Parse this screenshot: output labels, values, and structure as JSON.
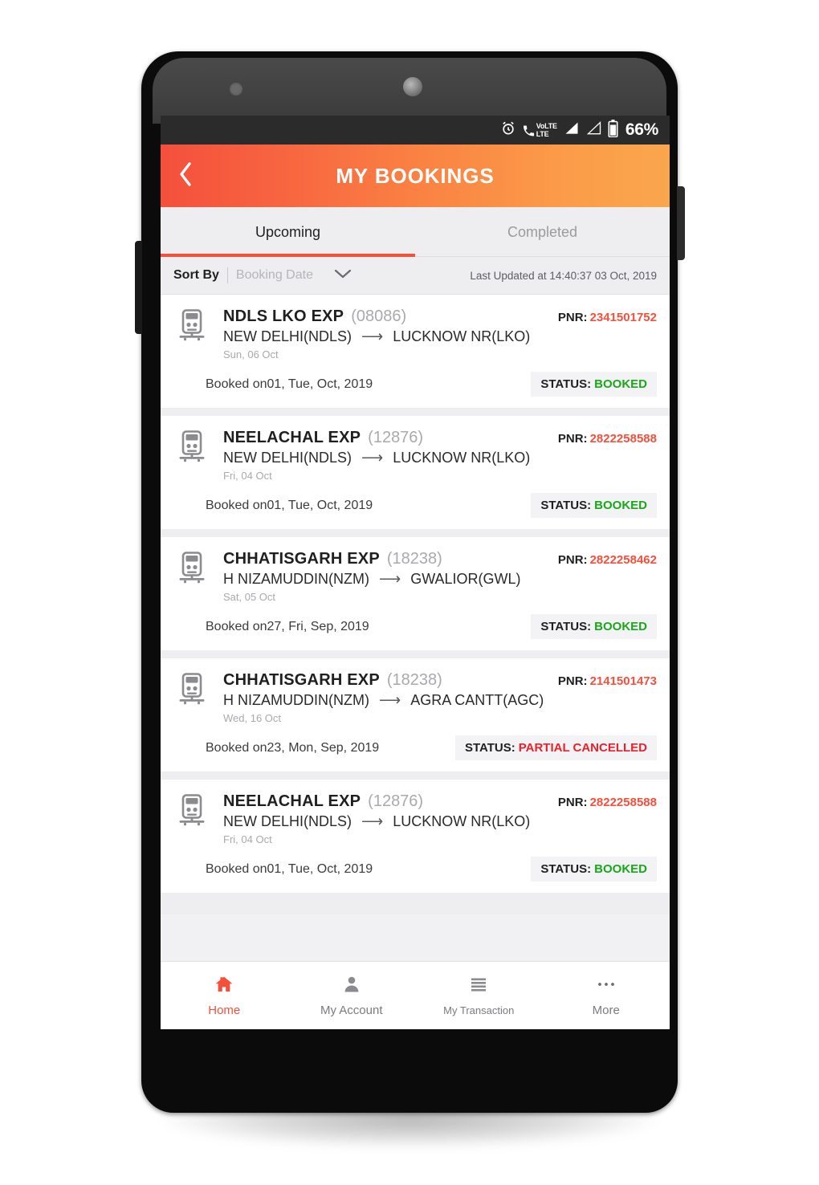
{
  "device": {
    "status_bar": {
      "alarm_icon": "alarm-clock-icon",
      "volte_icon": "volte-icon",
      "volte_text": "VoLTE",
      "lte_text": "LTE",
      "signal_icon_1": "signal-bars-icon",
      "signal_icon_2": "signal-bars-empty-icon",
      "battery_icon": "battery-icon",
      "battery_percent": "66%"
    }
  },
  "app_bar": {
    "back_icon": "chevron-left-icon",
    "title": "MY BOOKINGS",
    "gradient_start": "#f4503c",
    "gradient_end": "#faa64e"
  },
  "tabs": [
    {
      "label": "Upcoming",
      "active": true
    },
    {
      "label": "Completed",
      "active": false
    }
  ],
  "sort_bar": {
    "label": "Sort By",
    "value": "Booking Date",
    "chevron_icon": "chevron-down-icon",
    "last_updated": "Last Updated at 14:40:37 03 Oct, 2019"
  },
  "bookings": [
    {
      "train_icon": "train-icon",
      "train_name": "NDLS LKO EXP",
      "train_number": "(08086)",
      "from_station": "NEW DELHI(NDLS)",
      "arrow": "⟶",
      "to_station": "LUCKNOW NR(LKO)",
      "journey_date": "Sun, 06 Oct",
      "pnr_label": "PNR:",
      "pnr_value": "2341501752",
      "booked_on": "Booked on01, Tue, Oct, 2019",
      "status_label": "STATUS:",
      "status_value": "BOOKED",
      "status_type": "booked"
    },
    {
      "train_icon": "train-icon",
      "train_name": "NEELACHAL EXP",
      "train_number": "(12876)",
      "from_station": "NEW DELHI(NDLS)",
      "arrow": "⟶",
      "to_station": "LUCKNOW NR(LKO)",
      "journey_date": "Fri, 04 Oct",
      "pnr_label": "PNR:",
      "pnr_value": "2822258588",
      "booked_on": "Booked on01, Tue, Oct, 2019",
      "status_label": "STATUS:",
      "status_value": "BOOKED",
      "status_type": "booked"
    },
    {
      "train_icon": "train-icon",
      "train_name": "CHHATISGARH EXP",
      "train_number": "(18238)",
      "from_station": "H NIZAMUDDIN(NZM)",
      "arrow": "⟶",
      "to_station": "GWALIOR(GWL)",
      "journey_date": "Sat, 05 Oct",
      "pnr_label": "PNR:",
      "pnr_value": "2822258462",
      "booked_on": "Booked on27, Fri, Sep, 2019",
      "status_label": "STATUS:",
      "status_value": "BOOKED",
      "status_type": "booked"
    },
    {
      "train_icon": "train-icon",
      "train_name": "CHHATISGARH EXP",
      "train_number": "(18238)",
      "from_station": "H NIZAMUDDIN(NZM)",
      "arrow": "⟶",
      "to_station": "AGRA CANTT(AGC)",
      "journey_date": "Wed, 16 Oct",
      "pnr_label": "PNR:",
      "pnr_value": "2141501473",
      "booked_on": "Booked on23, Mon, Sep, 2019",
      "status_label": "STATUS:",
      "status_value": "PARTIAL CANCELLED",
      "status_type": "cancelled"
    },
    {
      "train_icon": "train-icon",
      "train_name": "NEELACHAL EXP",
      "train_number": "(12876)",
      "from_station": "NEW DELHI(NDLS)",
      "arrow": "⟶",
      "to_station": "LUCKNOW NR(LKO)",
      "journey_date": "Fri, 04 Oct",
      "pnr_label": "PNR:",
      "pnr_value": "2822258588",
      "booked_on": "Booked on01, Tue, Oct, 2019",
      "status_label": "STATUS:",
      "status_value": "BOOKED",
      "status_type": "booked"
    }
  ],
  "bottom_nav": [
    {
      "label": "Home",
      "icon": "home-icon",
      "active": true
    },
    {
      "label": "My Account",
      "icon": "person-icon",
      "active": false
    },
    {
      "label": "My Transaction",
      "icon": "list-lines-icon",
      "active": false
    },
    {
      "label": "More",
      "icon": "ellipsis-icon",
      "active": false
    }
  ],
  "colors": {
    "accent_red": "#f4503c",
    "accent_orange": "#faa64e",
    "status_booked_green": "#18a818",
    "status_cancelled_red": "#e8212b"
  }
}
